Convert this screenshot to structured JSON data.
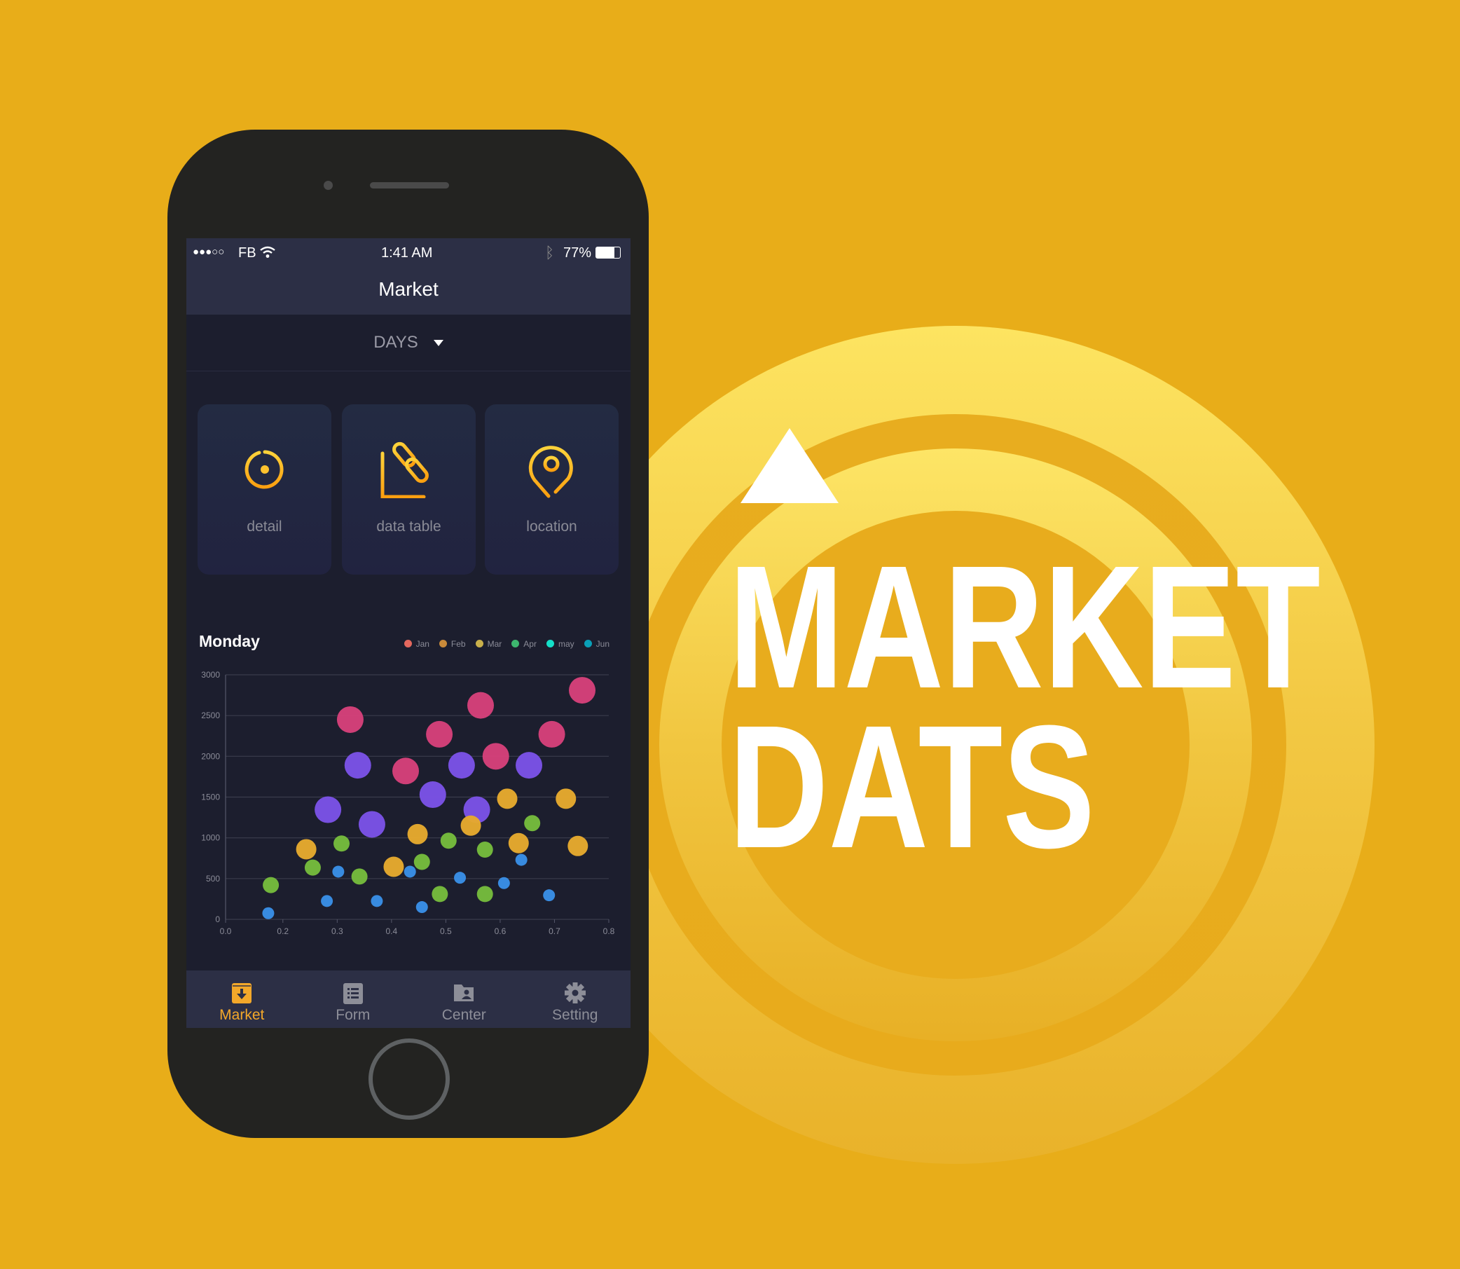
{
  "status_bar": {
    "signal": "●●●○○",
    "carrier": "FB",
    "time": "1:41 AM",
    "battery": "77%",
    "battery_level": 0.77
  },
  "nav": {
    "title": "Market"
  },
  "filter": {
    "selected": "DAYS"
  },
  "cards": [
    {
      "label": "detail",
      "icon": "crosshair-icon"
    },
    {
      "label": "data table",
      "icon": "chart-link-icon"
    },
    {
      "label": "location",
      "icon": "map-pin-icon"
    }
  ],
  "tabs": [
    {
      "label": "Market",
      "icon": "archive-download-icon",
      "active": true
    },
    {
      "label": "Form",
      "icon": "list-icon",
      "active": false
    },
    {
      "label": "Center",
      "icon": "folder-user-icon",
      "active": false
    },
    {
      "label": "Setting",
      "icon": "gear-icon",
      "active": false
    }
  ],
  "colors": {
    "accent": "#f3a82a",
    "background": "#e8ad19",
    "screen": "#1c1e2e",
    "bar": "#2c2f45"
  },
  "promo": {
    "line1": "MARKET",
    "line2": "DATS"
  },
  "chart_data": {
    "type": "scatter",
    "title": "Monday",
    "legend": [
      {
        "name": "Jan",
        "color": "#e4685e"
      },
      {
        "name": "Feb",
        "color": "#c98a3a"
      },
      {
        "name": "Mar",
        "color": "#c9b04b"
      },
      {
        "name": "Apr",
        "color": "#3db66e"
      },
      {
        "name": "may",
        "color": "#14dfc8"
      },
      {
        "name": "Jun",
        "color": "#0aa0b8"
      }
    ],
    "legend_position": "top-right",
    "x_ticks": [
      "0.0",
      "0.2",
      "0.3",
      "0.4",
      "0.5",
      "0.6",
      "0.7",
      "0.8"
    ],
    "y_ticks": [
      "0",
      "500",
      "1000",
      "1500",
      "2000",
      "2500",
      "3000"
    ],
    "ylim": [
      0,
      3000
    ],
    "grid": "horizontal",
    "series": [
      {
        "color": "#d6407a",
        "size": "large",
        "points": [
          [
            0.324,
            2450
          ],
          [
            0.488,
            2270
          ],
          [
            0.564,
            2625
          ],
          [
            0.751,
            2810
          ],
          [
            0.695,
            2270
          ],
          [
            0.592,
            2000
          ],
          [
            0.426,
            1820
          ]
        ]
      },
      {
        "color": "#7b52e6",
        "size": "large",
        "points": [
          [
            0.338,
            1890
          ],
          [
            0.283,
            1345
          ],
          [
            0.364,
            1165
          ],
          [
            0.476,
            1530
          ],
          [
            0.529,
            1890
          ],
          [
            0.557,
            1345
          ],
          [
            0.653,
            1890
          ]
        ]
      },
      {
        "color": "#e6a92e",
        "size": "medium",
        "points": [
          [
            0.243,
            860
          ],
          [
            0.404,
            645
          ],
          [
            0.448,
            1045
          ],
          [
            0.546,
            1150
          ],
          [
            0.613,
            1480
          ],
          [
            0.634,
            935
          ],
          [
            0.721,
            1480
          ],
          [
            0.743,
            900
          ]
        ]
      },
      {
        "color": "#76bb3d",
        "size": "small",
        "points": [
          [
            0.158,
            420
          ],
          [
            0.255,
            635
          ],
          [
            0.308,
            930
          ],
          [
            0.341,
            525
          ],
          [
            0.456,
            705
          ],
          [
            0.505,
            965
          ],
          [
            0.489,
            310
          ],
          [
            0.572,
            855
          ],
          [
            0.572,
            310
          ],
          [
            0.659,
            1180
          ]
        ]
      },
      {
        "color": "#3a8ee6",
        "size": "tiny",
        "points": [
          [
            0.149,
            75
          ],
          [
            0.281,
            225
          ],
          [
            0.302,
            585
          ],
          [
            0.373,
            225
          ],
          [
            0.434,
            585
          ],
          [
            0.456,
            150
          ],
          [
            0.526,
            510
          ],
          [
            0.607,
            445
          ],
          [
            0.639,
            730
          ],
          [
            0.69,
            295
          ]
        ]
      }
    ]
  }
}
